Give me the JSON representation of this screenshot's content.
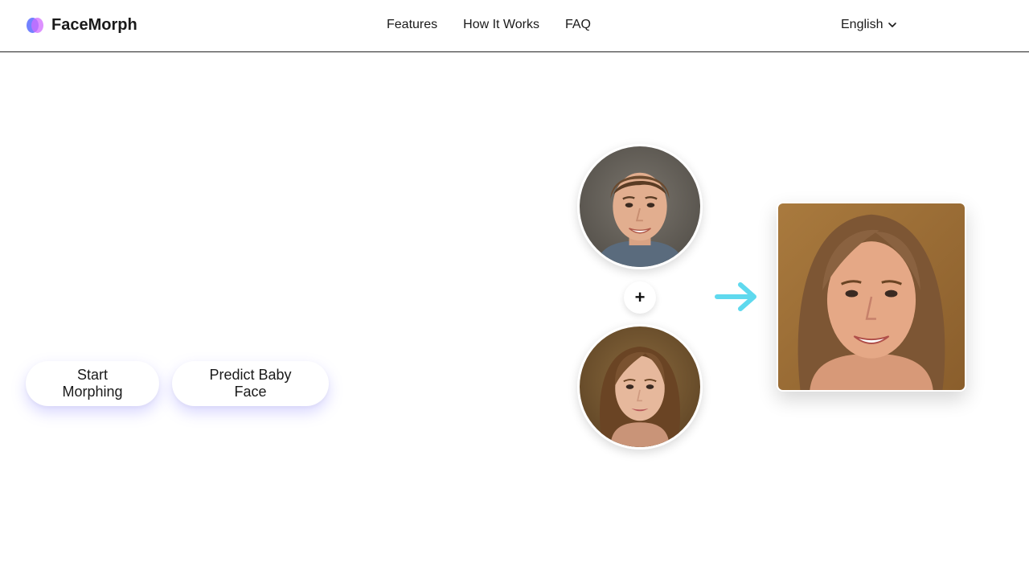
{
  "header": {
    "brand": "FaceMorph",
    "nav": [
      "Features",
      "How It Works",
      "FAQ"
    ],
    "language": "English"
  },
  "actions": {
    "start_label": "Start Morphing",
    "baby_label": "Predict Baby Face"
  },
  "morph": {
    "plus_symbol": "+",
    "arrow_color": "#5fd9ee"
  },
  "colors": {
    "logo_left": "#6a7bff",
    "logo_right": "#d26cff",
    "button_shadow": "#786eff"
  },
  "icons": {
    "logo": "facemorph-logo-icon",
    "language_caret": "chevron-down-icon",
    "plus": "plus-icon",
    "arrow": "arrow-right-icon"
  }
}
